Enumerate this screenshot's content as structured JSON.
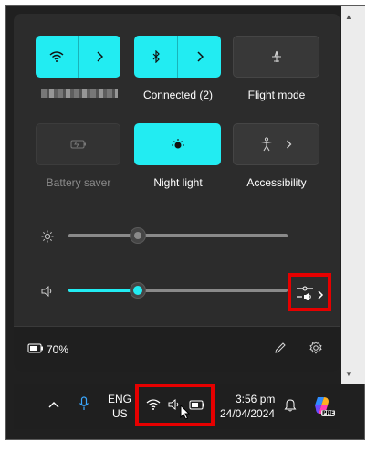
{
  "quick_settings": {
    "tiles": [
      {
        "id": "wifi",
        "label": "",
        "state": "on",
        "icon": "wifi-icon",
        "has_chevron": true
      },
      {
        "id": "bluetooth",
        "label": "Connected (2)",
        "state": "on",
        "icon": "bluetooth-icon",
        "has_chevron": true
      },
      {
        "id": "flight",
        "label": "Flight mode",
        "state": "off",
        "icon": "airplane-icon"
      },
      {
        "id": "battery_saver",
        "label": "Battery saver",
        "state": "disabled",
        "icon": "battery-saver-icon"
      },
      {
        "id": "night_light",
        "label": "Night light",
        "state": "on",
        "icon": "night-light-icon"
      },
      {
        "id": "accessibility",
        "label": "Accessibility",
        "state": "off",
        "icon": "accessibility-icon",
        "has_chevron": true
      }
    ],
    "brightness": {
      "icon": "brightness-icon",
      "level": 0.28
    },
    "volume": {
      "icon": "speaker-icon",
      "level": 0.32,
      "mixer_icon": "volume-mixer-icon"
    },
    "footer": {
      "battery_percent": "70%",
      "battery_icon": "battery-icon",
      "edit_icon": "pencil-icon",
      "settings_icon": "gear-icon"
    }
  },
  "taskbar": {
    "chevron_icon": "chevron-up-icon",
    "mic_icon": "microphone-icon",
    "language": {
      "line1": "ENG",
      "line2": "US"
    },
    "tray_icons": [
      "wifi-icon",
      "speaker-icon",
      "battery-icon"
    ],
    "time": "3:56 pm",
    "date": "24/04/2024",
    "notification_icon": "bell-icon",
    "copilot_icon": "copilot-icon",
    "copilot_badge": "PRE"
  },
  "colors": {
    "accent": "#22ecf2",
    "highlight": "#e60000",
    "panel": "#2c2c2c"
  }
}
